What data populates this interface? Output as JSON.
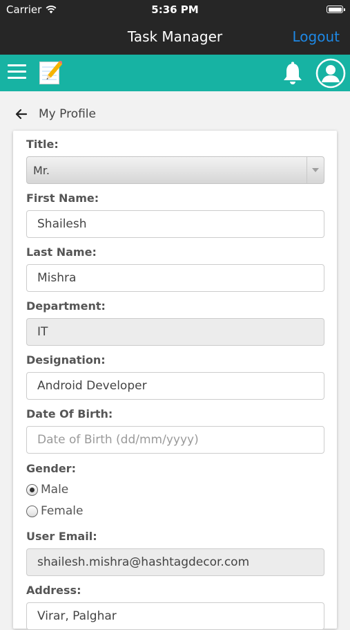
{
  "status_bar": {
    "carrier": "Carrier",
    "time": "5:36 PM"
  },
  "nav": {
    "title": "Task Manager",
    "logout_label": "Logout"
  },
  "toolbar": {
    "icons": [
      "menu-icon",
      "notepad-icon",
      "bell-icon",
      "profile-avatar-icon"
    ],
    "accent_color": "#17b3a3"
  },
  "page": {
    "title": "My Profile"
  },
  "form": {
    "title": {
      "label": "Title:",
      "value": "Mr."
    },
    "first_name": {
      "label": "First Name:",
      "value": "Shailesh"
    },
    "last_name": {
      "label": "Last Name:",
      "value": "Mishra"
    },
    "department": {
      "label": "Department:",
      "value": "IT"
    },
    "designation": {
      "label": "Designation:",
      "value": "Android Developer"
    },
    "dob": {
      "label": "Date Of Birth:",
      "placeholder": "Date of Birth (dd/mm/yyyy)"
    },
    "gender": {
      "label": "Gender:",
      "options": [
        "Male",
        "Female"
      ],
      "selected": "Male"
    },
    "email": {
      "label": "User Email:",
      "value": "shailesh.mishra@hashtagdecor.com"
    },
    "address": {
      "label": "Address:",
      "value": "Virar, Palghar"
    }
  }
}
